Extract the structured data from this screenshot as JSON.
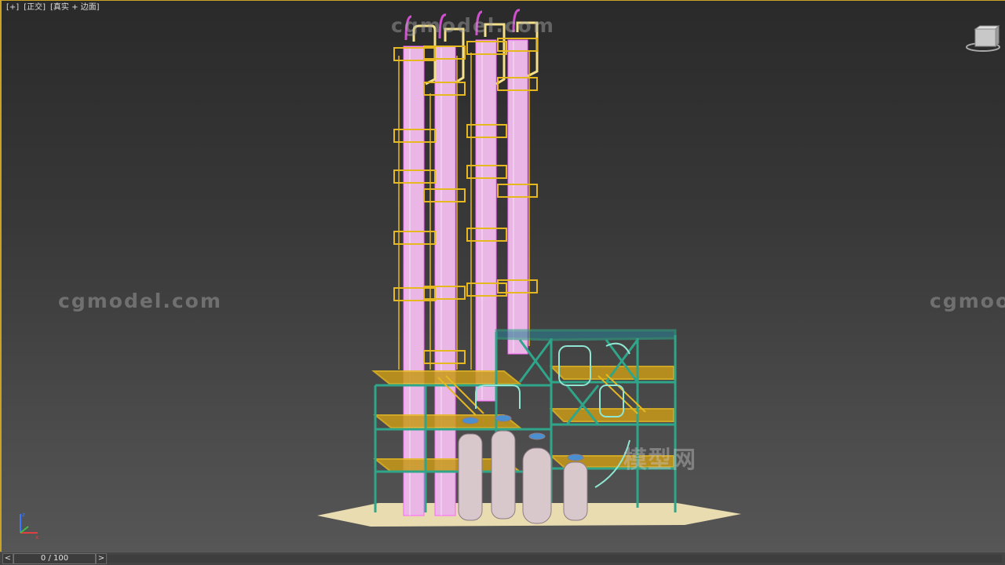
{
  "viewport": {
    "labels": [
      "[+]",
      "[正交]",
      "[真实 + 边面]"
    ]
  },
  "watermarks": {
    "top": "cgmodel.com",
    "left": "cgmodel.com",
    "right": "cgmoo",
    "cn": "模型网"
  },
  "timeline": {
    "prev": "<",
    "next": ">",
    "frame": "0 / 100"
  },
  "icons": {
    "viewcube": "viewcube-icon",
    "axis": "axis-tripod-icon"
  },
  "colors": {
    "viewport_border": "#c9a227",
    "column": "#f2c8f0",
    "platform": "#e6b820",
    "structure": "#2fa58a",
    "ground": "#e8dcb0"
  }
}
